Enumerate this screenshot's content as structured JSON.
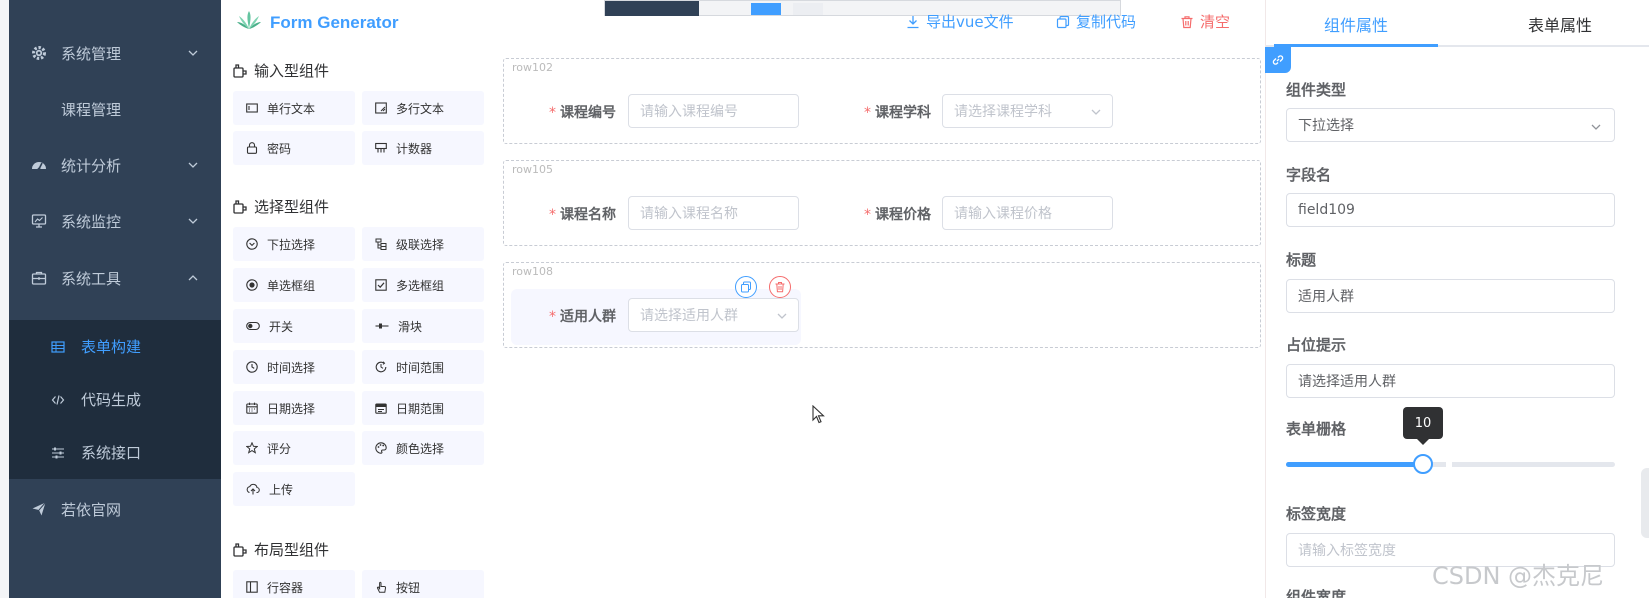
{
  "window": {
    "title": ""
  },
  "sidebar": {
    "items": [
      {
        "label": "系统管理",
        "icon": "gear-icon",
        "expandable": true
      },
      {
        "label": "课程管理",
        "icon": "",
        "expandable": false
      },
      {
        "label": "统计分析",
        "icon": "dashboard-icon",
        "expandable": true
      },
      {
        "label": "系统监控",
        "icon": "monitor-icon",
        "expandable": true
      },
      {
        "label": "系统工具",
        "icon": "toolbox-icon",
        "expandable": true
      }
    ],
    "sub_items": [
      {
        "label": "表单构建",
        "icon": "table-icon",
        "active": true
      },
      {
        "label": "代码生成",
        "icon": "code-icon",
        "active": false
      },
      {
        "label": "系统接口",
        "icon": "sliders-icon",
        "active": false
      }
    ],
    "bottom_item": {
      "label": "若依官网",
      "icon": "send-icon"
    }
  },
  "header": {
    "logo_text": "Form Generator",
    "actions": [
      {
        "label": "导出vue文件",
        "icon": "download-icon"
      },
      {
        "label": "复制代码",
        "icon": "copy-icon"
      },
      {
        "label": "清空",
        "icon": "delete-icon"
      }
    ]
  },
  "palette": {
    "groups": [
      {
        "title": "输入型组件",
        "items": [
          {
            "label": "单行文本",
            "icon": "input-icon"
          },
          {
            "label": "多行文本",
            "icon": "textarea-icon"
          },
          {
            "label": "密码",
            "icon": "lock-icon"
          },
          {
            "label": "计数器",
            "icon": "number-icon"
          }
        ]
      },
      {
        "title": "选择型组件",
        "items": [
          {
            "label": "下拉选择",
            "icon": "select-icon"
          },
          {
            "label": "级联选择",
            "icon": "cascader-icon"
          },
          {
            "label": "单选框组",
            "icon": "radio-icon"
          },
          {
            "label": "多选框组",
            "icon": "checkbox-icon"
          },
          {
            "label": "开关",
            "icon": "switch-icon"
          },
          {
            "label": "滑块",
            "icon": "slider-icon"
          },
          {
            "label": "时间选择",
            "icon": "clock-icon"
          },
          {
            "label": "时间范围",
            "icon": "time-range-icon"
          },
          {
            "label": "日期选择",
            "icon": "calendar-icon"
          },
          {
            "label": "日期范围",
            "icon": "date-range-icon"
          },
          {
            "label": "评分",
            "icon": "star-icon"
          },
          {
            "label": "颜色选择",
            "icon": "palette-icon"
          },
          {
            "label": "上传",
            "icon": "upload-icon"
          }
        ]
      },
      {
        "title": "布局型组件",
        "items": [
          {
            "label": "行容器",
            "icon": "row-icon"
          },
          {
            "label": "按钮",
            "icon": "hand-icon"
          }
        ]
      }
    ]
  },
  "canvas": {
    "rows": [
      {
        "tag": "row102",
        "fields": [
          {
            "label": "课程编号",
            "placeholder": "请输入课程编号",
            "type": "input"
          },
          {
            "label": "课程学科",
            "placeholder": "请选择课程学科",
            "type": "select"
          }
        ]
      },
      {
        "tag": "row105",
        "fields": [
          {
            "label": "课程名称",
            "placeholder": "请输入课程名称",
            "type": "input"
          },
          {
            "label": "课程价格",
            "placeholder": "请输入课程价格",
            "type": "input"
          }
        ]
      },
      {
        "tag": "row108",
        "fields": [
          {
            "label": "适用人群",
            "placeholder": "请选择适用人群",
            "type": "select"
          }
        ]
      }
    ]
  },
  "right_panel": {
    "tabs": [
      "组件属性",
      "表单属性"
    ],
    "active_tab": 0,
    "props": {
      "component_type": {
        "label": "组件类型",
        "value": "下拉选择"
      },
      "field_name": {
        "label": "字段名",
        "value": "field109"
      },
      "title": {
        "label": "标题",
        "value": "适用人群"
      },
      "placeholder": {
        "label": "占位提示",
        "value": "请选择适用人群"
      },
      "grid": {
        "label": "表单栅格",
        "value": 10,
        "tooltip": "10",
        "max": 24
      },
      "label_width": {
        "label": "标签宽度",
        "placeholder": "请输入标签宽度"
      },
      "component_width": {
        "label": "组件宽度"
      }
    }
  },
  "watermark": "CSDN @杰克尼",
  "colors": {
    "primary": "#409eff",
    "danger": "#f56c6c",
    "sidebar_bg": "#304156",
    "submenu_bg": "#1f2d3d"
  }
}
